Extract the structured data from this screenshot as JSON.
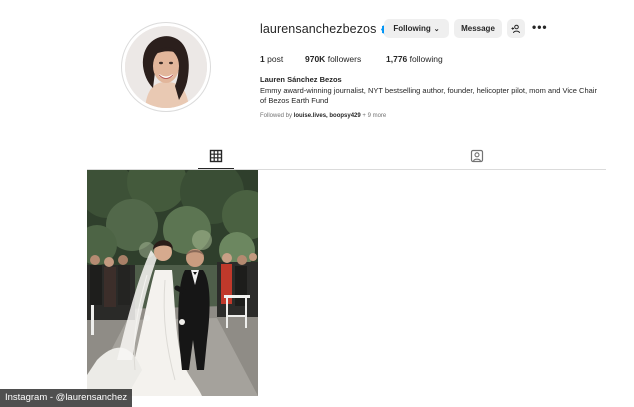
{
  "profile": {
    "username": "laurensanchezbezos",
    "verified_icon": "verified-badge-icon",
    "full_name": "Lauren Sánchez Bezos",
    "bio": "Emmy award-winning journalist, NYT bestselling author, founder, helicopter pilot, mom and Vice Chair of Bezos Earth Fund"
  },
  "actions": {
    "following_label": "Following",
    "message_label": "Message",
    "suggest_icon": "add-person-icon",
    "more_icon": "more-dots-icon"
  },
  "stats": {
    "posts_count": "1",
    "posts_label": "post",
    "followers_count": "970K",
    "followers_label": "followers",
    "following_count": "1,776",
    "following_label": "following"
  },
  "followed_by": {
    "prefix": "Followed by",
    "user1": "louise.lives",
    "separator": ",",
    "user2": "boopsy429",
    "suffix": "+ 9 more"
  },
  "tabs": {
    "posts_icon": "grid-icon",
    "tagged_icon": "tagged-icon",
    "active": "posts"
  },
  "colors": {
    "verified_blue": "#0095f6",
    "button_bg": "#efefef",
    "divider": "#dbdbdb"
  },
  "credit": {
    "text": "Instagram - @laurensanchez"
  }
}
